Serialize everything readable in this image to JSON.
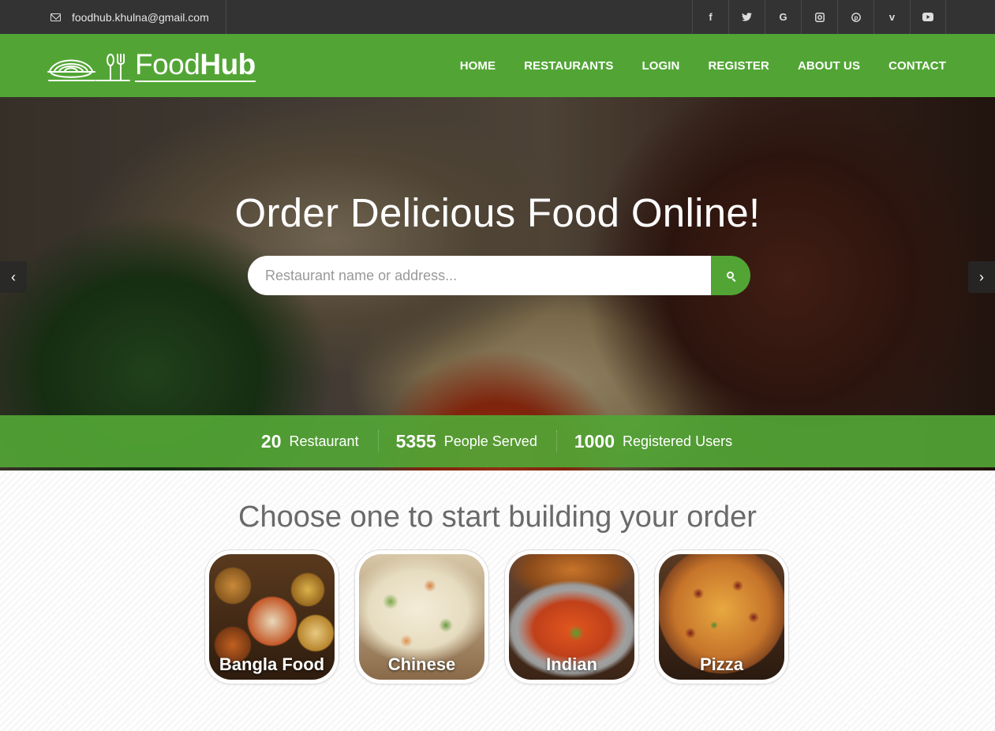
{
  "topbar": {
    "email": "foodhub.khulna@gmail.com",
    "socials": [
      {
        "icon": "facebook-icon",
        "glyph": "f"
      },
      {
        "icon": "twitter-icon",
        "glyph": "🐦"
      },
      {
        "icon": "google-icon",
        "glyph": "G"
      },
      {
        "icon": "instagram-icon",
        "glyph": "◘"
      },
      {
        "icon": "pinterest-icon",
        "glyph": "℗"
      },
      {
        "icon": "vimeo-icon",
        "glyph": "v"
      },
      {
        "icon": "youtube-icon",
        "glyph": "▶"
      }
    ]
  },
  "brand": {
    "name_light": "Food",
    "name_bold": "Hub"
  },
  "nav": {
    "items": [
      "HOME",
      "RESTAURANTS",
      "LOGIN",
      "REGISTER",
      "ABOUT US",
      "CONTACT"
    ]
  },
  "hero": {
    "title": "Order Delicious Food Online!",
    "search_placeholder": "Restaurant name or address..."
  },
  "stats": [
    {
      "value": "20",
      "label": "Restaurant"
    },
    {
      "value": "5355",
      "label": "People Served"
    },
    {
      "value": "1000",
      "label": "Registered Users"
    }
  ],
  "categories": {
    "heading": "Choose one to start building your order",
    "items": [
      "Bangla Food",
      "Chinese",
      "Indian",
      "Pizza"
    ]
  },
  "colors": {
    "brand_green": "#52a535",
    "topbar_dark": "#333333"
  }
}
